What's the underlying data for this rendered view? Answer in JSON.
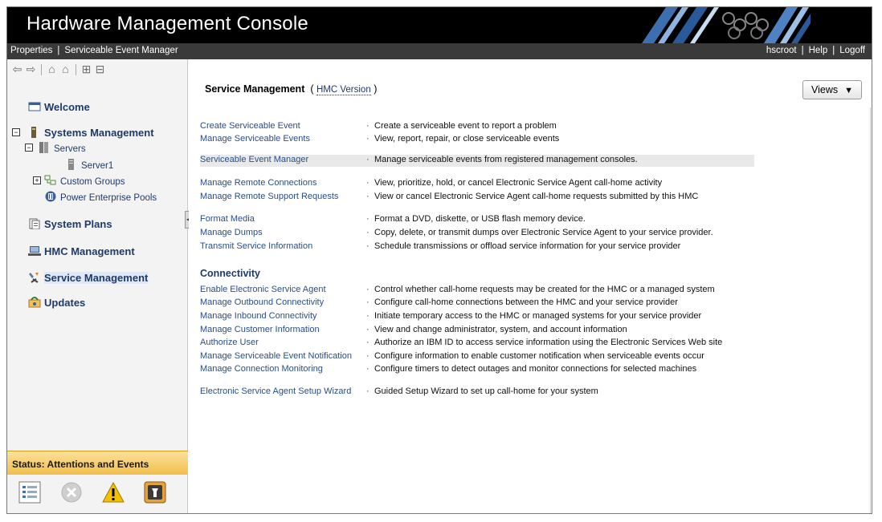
{
  "app": {
    "title": "Hardware Management Console"
  },
  "menubar": {
    "left": [
      "Properties",
      "Serviceable Event Manager"
    ],
    "right": [
      "hscroot",
      "Help",
      "Logoff"
    ]
  },
  "sidebar": {
    "items": {
      "welcome": "Welcome",
      "systems_management": "Systems Management",
      "servers": "Servers",
      "server1": "Server1",
      "custom_groups": "Custom Groups",
      "power_pools": "Power Enterprise Pools",
      "system_plans": "System Plans",
      "hmc_management": "HMC Management",
      "service_management": "Service Management",
      "updates": "Updates"
    },
    "status": {
      "header": "Status: Attentions and Events"
    }
  },
  "main": {
    "title": "Service Management",
    "version_open": "(",
    "version_link": "HMC Version",
    "version_close": ")",
    "views_label": "Views",
    "bullet": "·",
    "connectivity_heading": "Connectivity",
    "tasks": [
      {
        "link": "Create Serviceable Event",
        "desc": "Create a serviceable event to report a problem"
      },
      {
        "link": "Manage Serviceable Events",
        "desc": "View, report, repair, or close serviceable events"
      },
      {
        "link": "Serviceable Event Manager",
        "desc": "Manage serviceable events from registered management consoles."
      },
      {
        "link": "Manage Remote Connections",
        "desc": "View, prioritize, hold, or cancel Electronic Service Agent call-home activity"
      },
      {
        "link": "Manage Remote Support Requests",
        "desc": "View or cancel Electronic Service Agent call-home requests submitted by this HMC"
      },
      {
        "link": "Format Media",
        "desc": "Format a DVD, diskette, or USB flash memory device."
      },
      {
        "link": "Manage Dumps",
        "desc": "Copy, delete, or transmit dumps over Electronic Service Agent to your service provider."
      },
      {
        "link": "Transmit Service Information",
        "desc": "Schedule transmissions or offload service information for your service provider"
      },
      {
        "link": "Enable Electronic Service Agent",
        "desc": "Control whether call-home requests may be created for the HMC or a managed system"
      },
      {
        "link": "Manage Outbound Connectivity",
        "desc": "Configure call-home connections between the HMC and your service provider"
      },
      {
        "link": "Manage Inbound Connectivity",
        "desc": "Initiate temporary access to the HMC or managed systems for your service provider"
      },
      {
        "link": "Manage Customer Information",
        "desc": "View and change administrator, system, and account information"
      },
      {
        "link": "Authorize User",
        "desc": "Authorize an IBM ID to access service information using the Electronic Services Web site"
      },
      {
        "link": "Manage Serviceable Event Notification",
        "desc": "Configure information to enable customer notification when serviceable events occur"
      },
      {
        "link": "Manage Connection Monitoring",
        "desc": "Configure timers to detect outages and monitor connections for selected machines"
      },
      {
        "link": "Electronic Service Agent Setup Wizard",
        "desc": "Guided Setup Wizard to set up call-home for your system"
      }
    ]
  },
  "colors": {
    "link": "#2a4d86",
    "title_bar": "#000000",
    "menubar": "#3a3a3a",
    "status_header": "#f2be4a",
    "selected_nav": "#dfe8f6"
  },
  "icons": [
    "back-arrow-icon",
    "forward-arrow-icon",
    "home-icon",
    "favorites-icon",
    "expand-all-icon",
    "collapse-all-icon",
    "welcome-icon",
    "systems-icon",
    "servers-icon",
    "server-icon",
    "custom-groups-icon",
    "power-pools-icon",
    "system-plans-icon",
    "hmc-management-icon",
    "service-management-icon",
    "updates-icon",
    "status-list-icon",
    "error-icon",
    "warning-icon",
    "service-event-icon"
  ]
}
